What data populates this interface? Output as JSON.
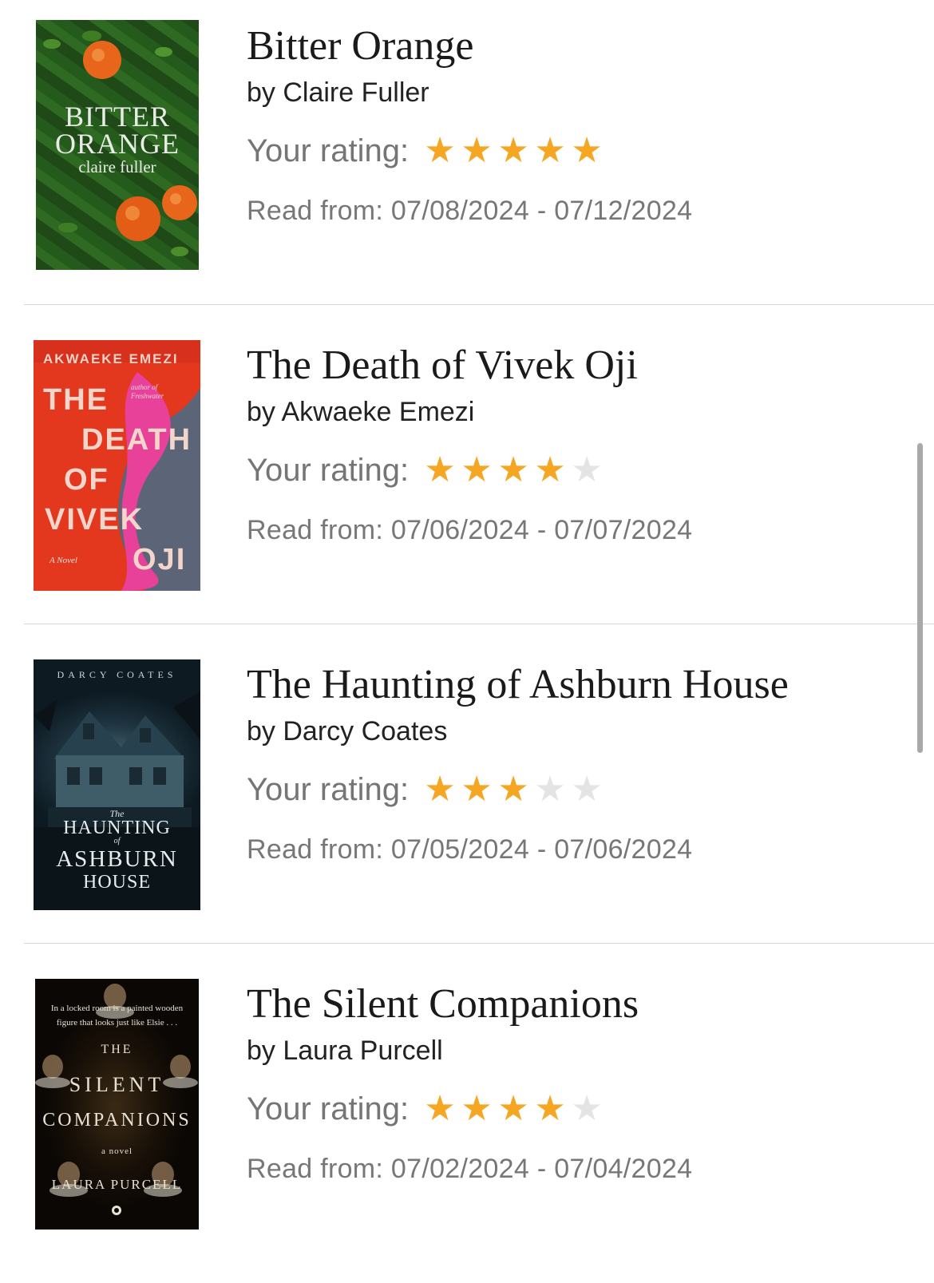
{
  "books": [
    {
      "title": "Bitter Orange",
      "author": "by Claire Fuller",
      "rating_label": "Your rating:",
      "rating": 5,
      "dates": "Read from: 07/08/2024 - 07/12/2024",
      "cover": {
        "line1": "BITTER",
        "line2": "ORANGE",
        "line3": "claire fuller"
      }
    },
    {
      "title": "The Death of Vivek Oji",
      "author": "by Akwaeke Emezi",
      "rating_label": "Your rating:",
      "rating": 4,
      "dates": "Read from: 07/06/2024 - 07/07/2024",
      "cover": {
        "author": "AKWAEKE EMEZI",
        "w1": "THE",
        "w2": "DEATH",
        "w3": "OF",
        "w4": "VIVEK",
        "w5": "OJI",
        "tag": "A Novel",
        "blurb": "author of Freshwater"
      }
    },
    {
      "title": "The Haunting of Ashburn House",
      "author": "by Darcy Coates",
      "rating_label": "Your rating:",
      "rating": 3,
      "dates": "Read from: 07/05/2024 - 07/06/2024",
      "cover": {
        "author": "DARCY COATES",
        "w1": "The",
        "w2": "HAUNTING",
        "w3": "of",
        "w4": "ASHBURN",
        "w5": "HOUSE"
      }
    },
    {
      "title": "The Silent Companions",
      "author": "by Laura Purcell",
      "rating_label": "Your rating:",
      "rating": 4,
      "dates": "Read from: 07/02/2024 - 07/04/2024",
      "cover": {
        "blurb": "In a locked room is a painted wooden figure that looks just like Elsie . . .",
        "w1": "THE",
        "w2": "SILENT",
        "w3": "COMPANIONS",
        "tag": "a novel",
        "author": "LAURA PURCELL"
      }
    }
  ],
  "colors": {
    "star_on": "#f5a623",
    "star_off": "#e4e4e4"
  }
}
